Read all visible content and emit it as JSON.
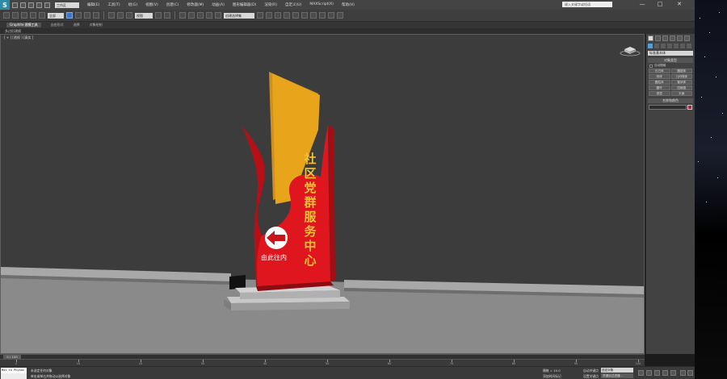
{
  "titlebar": {
    "workspace": "工作区",
    "menus": [
      "编辑(E)",
      "工具(T)",
      "组(G)",
      "视图(V)",
      "创建(C)",
      "修改器(M)",
      "动画(A)",
      "图形编辑器(D)",
      "渲染(R)",
      "自定义(U)",
      "MAXScript(X)",
      "帮助(H)"
    ],
    "search_placeholder": "键入关键字或短语",
    "minimize": "—",
    "restore": "□",
    "close": "✕"
  },
  "toolbar": {
    "filter_select": "全部",
    "view_select": "视图",
    "selection_set": "创建选择集"
  },
  "ribbon": {
    "tabs": [
      "Graphite 建模工具",
      "自由形式",
      "选择",
      "对象绘制"
    ],
    "active_tab": "Graphite 建模工具",
    "sub_label": "多边形建模"
  },
  "viewport": {
    "label": "[ + ] [透视 ] [真实 ]"
  },
  "sign": {
    "vertical_text": [
      "社",
      "区",
      "党",
      "群",
      "服",
      "务",
      "中",
      "心"
    ],
    "direction_text": "由此往内",
    "red": "#e0161e",
    "gold": "#e8a41a"
  },
  "command_panel": {
    "dropdown": "标准基本体",
    "object_type_title": "对象类型",
    "auto_grid": "自动栅格",
    "buttons": [
      "长方体",
      "圆锥体",
      "球体",
      "几何球体",
      "圆柱体",
      "管状体",
      "圆环",
      "四棱锥",
      "茶壶",
      "平面"
    ],
    "name_color_title": "名称和颜色",
    "swatch_color": "#a8233c"
  },
  "timeline": {
    "slider": "0 / 100",
    "ticks": [
      "0",
      "10",
      "20",
      "30",
      "40",
      "50",
      "60",
      "70",
      "80",
      "90",
      "100"
    ]
  },
  "status": {
    "maxscript": "Max to Physac",
    "line1": "未选定任何对象",
    "line2": "单击或单击并拖动以选择对象",
    "grid": "栅格 = 10.0",
    "add_time_tag": "添加时间标记",
    "auto_key": "自动关键点",
    "auto_key_select": "选定对象",
    "set_key": "设置关键点",
    "key_filter": "关键点过滤器..."
  }
}
